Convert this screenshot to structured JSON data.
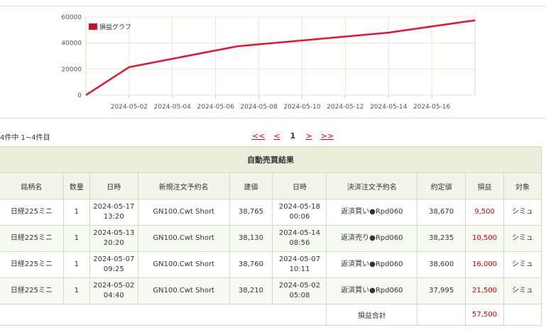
{
  "chart_data": {
    "type": "line",
    "legend": [
      "損益グラフ"
    ],
    "legend_position": "top-left",
    "series": [
      {
        "name": "損益グラフ",
        "x": [
          "2024-04-30",
          "2024-05-02",
          "2024-05-07",
          "2024-05-14",
          "2024-05-18"
        ],
        "values": [
          0,
          21500,
          37500,
          48000,
          57500
        ]
      }
    ],
    "x_ticks": [
      "2024-05-02",
      "2024-05-04",
      "2024-05-06",
      "2024-05-08",
      "2024-05-10",
      "2024-05-12",
      "2024-05-14",
      "2024-05-16"
    ],
    "y_ticks": [
      "0",
      "20000",
      "40000",
      "60000"
    ],
    "ylim": [
      0,
      60000
    ],
    "xlim": [
      "2024-04-30",
      "2024-05-18"
    ],
    "grid": true,
    "line_color": "#c8102e"
  },
  "pagination": {
    "count_text": "4件中 1~4件目",
    "first": "<<",
    "prev": "<",
    "current": "1",
    "next": ">",
    "last": ">>"
  },
  "table": {
    "caption": "自動売買結果",
    "headers": [
      "銘柄名",
      "数量",
      "日時",
      "新規注文予約名",
      "建値",
      "日時",
      "決済注文予約名",
      "約定値",
      "損益",
      "対象"
    ],
    "rows": [
      {
        "name": "日経225ミニ",
        "qty": "1",
        "open_date": "2024-05-17",
        "open_time": "13:20",
        "open_order": "GN100.Cwt Short",
        "open_price": "38,765",
        "close_date": "2024-05-18",
        "close_time": "00:06",
        "close_order": "返済買い●Rpd060",
        "close_price": "38,670",
        "pnl": "9,500",
        "target": "シミュ"
      },
      {
        "name": "日経225ミニ",
        "qty": "1",
        "open_date": "2024-05-13",
        "open_time": "20:20",
        "open_order": "GN100.Cwt Short",
        "open_price": "38,130",
        "close_date": "2024-05-14",
        "close_time": "08:56",
        "close_order": "返済売り●Rpd060",
        "close_price": "38,235",
        "pnl": "10,500",
        "target": "シミュ"
      },
      {
        "name": "日経225ミニ",
        "qty": "1",
        "open_date": "2024-05-07",
        "open_time": "09:25",
        "open_order": "GN100.Cwt Short",
        "open_price": "38,760",
        "close_date": "2024-05-07",
        "close_time": "10:11",
        "close_order": "返済買い●Rpd060",
        "close_price": "38,600",
        "pnl": "16,000",
        "target": "シミュ"
      },
      {
        "name": "日経225ミニ",
        "qty": "1",
        "open_date": "2024-05-02",
        "open_time": "04:40",
        "open_order": "GN100.Cwt Short",
        "open_price": "38,210",
        "close_date": "2024-05-02",
        "close_time": "05:08",
        "close_order": "返済買い●Rpd060",
        "close_price": "37,995",
        "pnl": "21,500",
        "target": "シミュ"
      }
    ],
    "total_label": "損益合計",
    "total_value": "57,500",
    "profit_color": "#cc0000"
  }
}
